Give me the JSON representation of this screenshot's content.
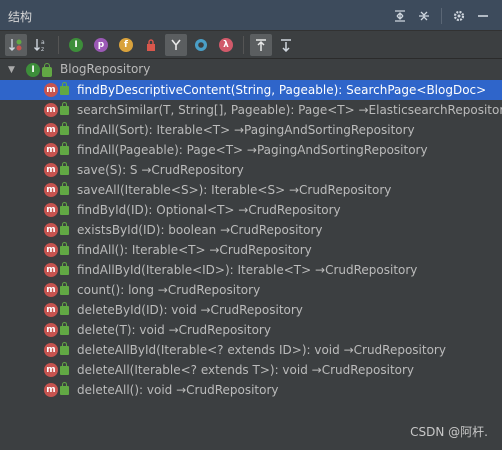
{
  "panel": {
    "title": "结构",
    "header_icons": [
      "expand-all-icon",
      "collapse-all-icon",
      "gear-icon",
      "hide-icon"
    ]
  },
  "toolbar": {
    "buttons": [
      "sort-by-type-icon",
      "sort-alphabetically-icon",
      "show-inherited-icon",
      "show-properties-icon",
      "show-fields-icon",
      "show-non-public-icon",
      "show-anonymous-icon",
      "show-lambdas-icon",
      "autoscroll-to-source-icon",
      "autoscroll-from-source-icon"
    ],
    "sort_alpha_label": "a↓z"
  },
  "tree": {
    "root": {
      "label": "BlogRepository",
      "icon_letter": "I"
    },
    "method_icon_letter": "m",
    "members": [
      {
        "name": "findByDescriptiveContent(String, Pageable): SearchPage<BlogDoc>",
        "selected": true
      },
      {
        "name": "searchSimilar(T, String[], Pageable): Page<T> →ElasticsearchRepository"
      },
      {
        "name": "findAll(Sort): Iterable<T> →PagingAndSortingRepository"
      },
      {
        "name": "findAll(Pageable): Page<T> →PagingAndSortingRepository"
      },
      {
        "name": "save(S): S →CrudRepository"
      },
      {
        "name": "saveAll(Iterable<S>): Iterable<S> →CrudRepository"
      },
      {
        "name": "findById(ID): Optional<T> →CrudRepository"
      },
      {
        "name": "existsById(ID): boolean →CrudRepository"
      },
      {
        "name": "findAll(): Iterable<T> →CrudRepository"
      },
      {
        "name": "findAllById(Iterable<ID>): Iterable<T> →CrudRepository"
      },
      {
        "name": "count(): long →CrudRepository"
      },
      {
        "name": "deleteById(ID): void →CrudRepository"
      },
      {
        "name": "delete(T): void →CrudRepository"
      },
      {
        "name": "deleteAllById(Iterable<? extends ID>): void →CrudRepository"
      },
      {
        "name": "deleteAll(Iterable<? extends T>): void →CrudRepository"
      },
      {
        "name": "deleteAll(): void →CrudRepository"
      }
    ]
  },
  "watermark": "CSDN @阿杆."
}
